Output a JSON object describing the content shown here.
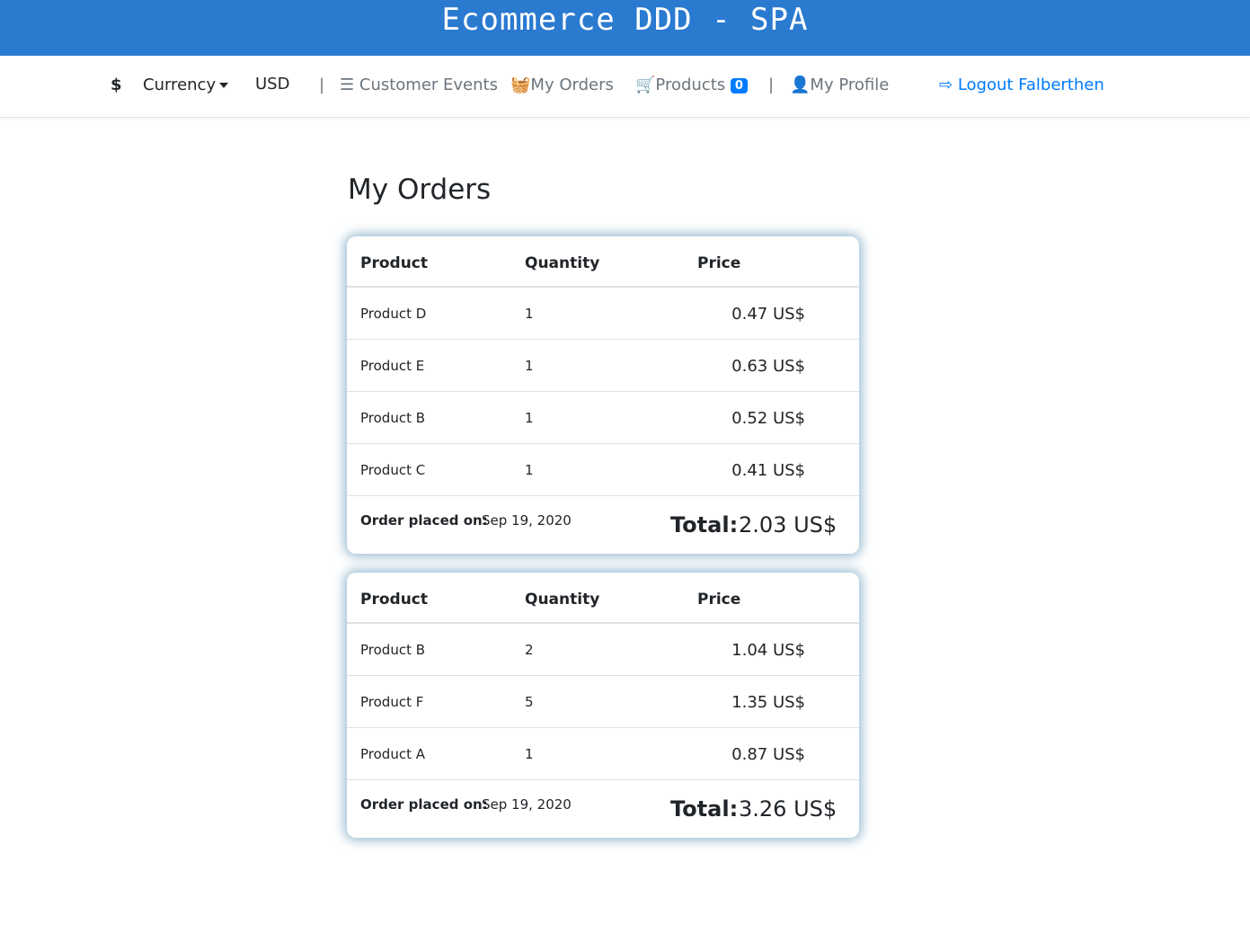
{
  "header": {
    "title": "Ecommerce DDD - SPA",
    "brand_color": "#2a7ad0"
  },
  "nav": {
    "currency_icon": "dollar-icon",
    "currency_label": "Currency",
    "currency_value": "USD",
    "separator": "|",
    "customer_events": "Customer Events",
    "my_orders": "My Orders",
    "products": "Products",
    "cart_count": "0",
    "my_profile": "My Profile",
    "logout": "Logout Falberthen"
  },
  "page": {
    "title": "My Orders"
  },
  "table_headers": {
    "product": "Product",
    "quantity": "Quantity",
    "price": "Price"
  },
  "orders": [
    {
      "items": [
        {
          "product": "Product D",
          "quantity": "1",
          "price": "0.47 US$"
        },
        {
          "product": "Product E",
          "quantity": "1",
          "price": "0.63 US$"
        },
        {
          "product": "Product B",
          "quantity": "1",
          "price": "0.52 US$"
        },
        {
          "product": "Product C",
          "quantity": "1",
          "price": "0.41 US$"
        }
      ],
      "placed_label": "Order placed on:",
      "placed_on": "Sep 19, 2020",
      "total_label": "Total:",
      "total": "2.03 US$"
    },
    {
      "items": [
        {
          "product": "Product B",
          "quantity": "2",
          "price": "1.04 US$"
        },
        {
          "product": "Product F",
          "quantity": "5",
          "price": "1.35 US$"
        },
        {
          "product": "Product A",
          "quantity": "1",
          "price": "0.87 US$"
        }
      ],
      "placed_label": "Order placed on:",
      "placed_on": "Sep 19, 2020",
      "total_label": "Total:",
      "total": "3.26 US$"
    }
  ]
}
